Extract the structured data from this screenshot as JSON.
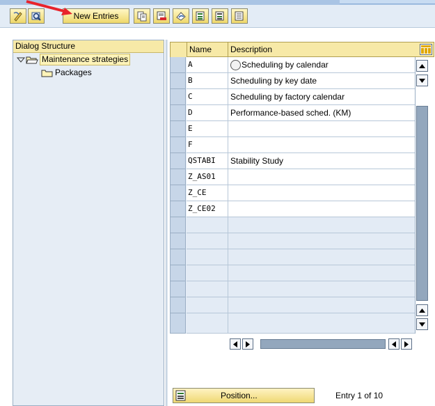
{
  "toolbar": {
    "new_entries_label": "New Entries",
    "icons": [
      "display-change-icon",
      "details-icon",
      "copy-icon",
      "delete-icon",
      "undo-icon",
      "select-all-icon",
      "select-block-icon",
      "deselect-all-icon"
    ]
  },
  "dialog_structure": {
    "header": "Dialog Structure",
    "items": [
      {
        "label": "Maintenance strategies",
        "expanded": true,
        "selected": true
      },
      {
        "label": "Packages",
        "expanded": false,
        "selected": false
      }
    ]
  },
  "table": {
    "columns": [
      "Name",
      "Description"
    ],
    "rows": [
      {
        "name": "A",
        "description": "Scheduling by calendar"
      },
      {
        "name": "B",
        "description": "Scheduling by key date"
      },
      {
        "name": "C",
        "description": "Scheduling by factory calendar"
      },
      {
        "name": "D",
        "description": "Performance-based sched. (KM)"
      },
      {
        "name": "E",
        "description": ""
      },
      {
        "name": "F",
        "description": ""
      },
      {
        "name": "QSTABI",
        "description": "Stability Study"
      },
      {
        "name": "Z_AS01",
        "description": ""
      },
      {
        "name": "Z_CE",
        "description": ""
      },
      {
        "name": "Z_CE02",
        "description": ""
      }
    ],
    "empty_rows": 7
  },
  "footer": {
    "position_label": "Position...",
    "entry_info": "Entry 1 of 10"
  },
  "colors": {
    "header_yellow": "#f7e9a7",
    "panel_blue": "#e6edf5",
    "accent_red": "#e8232b"
  }
}
